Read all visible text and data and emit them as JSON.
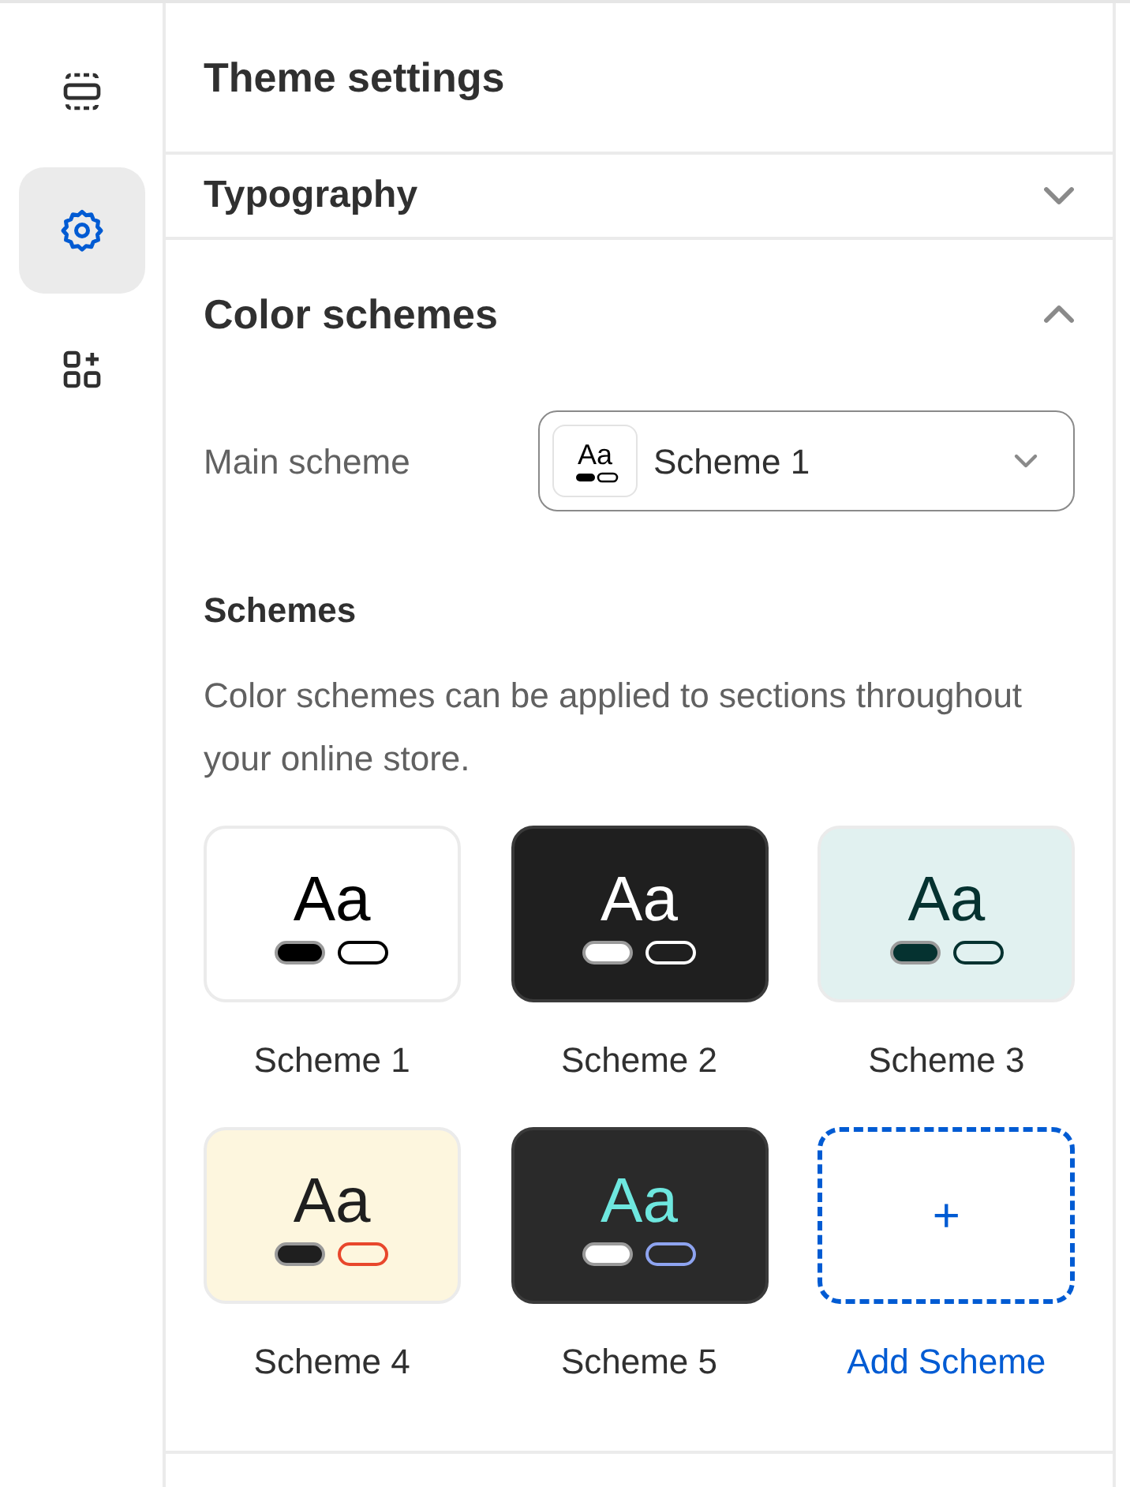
{
  "rail": [
    {
      "kind": "sections",
      "selected": false
    },
    {
      "kind": "settings",
      "selected": true
    },
    {
      "kind": "apps",
      "selected": false
    }
  ],
  "header": {
    "title": "Theme settings"
  },
  "typography": {
    "title": "Typography",
    "expanded": false
  },
  "color_schemes": {
    "title": "Color schemes",
    "expanded": true,
    "main_scheme": {
      "label": "Main scheme",
      "value": "Scheme 1",
      "preview_sample": "Aa"
    },
    "schemes_heading": "Schemes",
    "description": "Color schemes can be applied to sections throughout your online store.",
    "schemes": [
      {
        "name": "Scheme 1",
        "sample": "Aa",
        "color": "#ffffff",
        "text": {
          "color": "#000000"
        },
        "swatches": [
          {
            "color": "#000000"
          },
          {
            "color": "#000000"
          }
        ]
      },
      {
        "name": "Scheme 2",
        "sample": "Aa",
        "color": "#1f1f1f",
        "text": {
          "color": "#ffffff"
        },
        "swatches": [
          {
            "color": "#ffffff"
          },
          {
            "color": "#ffffff"
          }
        ]
      },
      {
        "name": "Scheme 3",
        "sample": "Aa",
        "color": "#e1f1f0",
        "text": {
          "color": "#053230"
        },
        "swatches": [
          {
            "color": "#053230"
          },
          {
            "color": "#053230"
          }
        ]
      },
      {
        "name": "Scheme 4",
        "sample": "Aa",
        "color": "#fdf6de",
        "text": {
          "color": "#1f1f1f"
        },
        "swatches": [
          {
            "color": "#1f1f1f"
          },
          {
            "color": "#e8472c"
          }
        ]
      },
      {
        "name": "Scheme 5",
        "sample": "Aa",
        "color": "#2a2a2a",
        "text": {
          "color": "#6ee7df"
        },
        "swatches": [
          {
            "color": "#ffffff"
          },
          {
            "color": "#8ea4f0"
          }
        ]
      }
    ],
    "add_button": {
      "icon": "+",
      "label": "Add Scheme"
    }
  }
}
